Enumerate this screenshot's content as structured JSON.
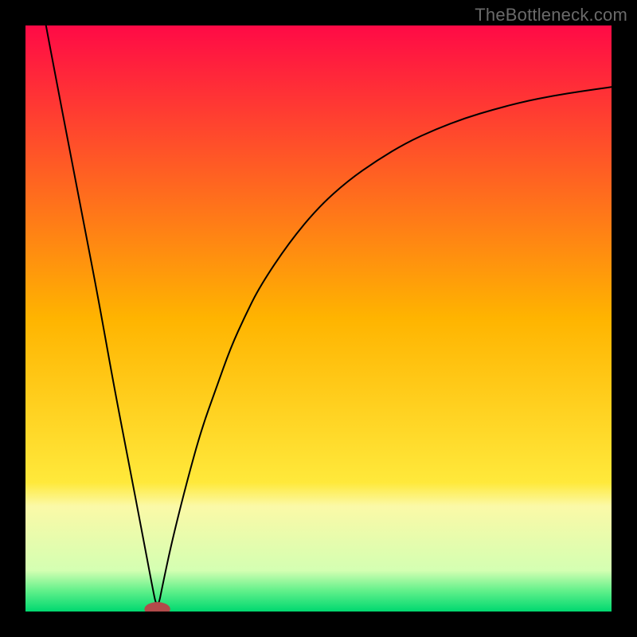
{
  "watermark": "TheBottleneck.com",
  "chart_data": {
    "type": "line",
    "title": "",
    "xlabel": "",
    "ylabel": "",
    "xlim": [
      0,
      100
    ],
    "ylim": [
      0,
      100
    ],
    "grid": false,
    "legend": false,
    "background_gradient": {
      "stops": [
        {
          "offset": 0.0,
          "color": "#ff0a46"
        },
        {
          "offset": 0.5,
          "color": "#ffb400"
        },
        {
          "offset": 0.78,
          "color": "#ffe93b"
        },
        {
          "offset": 0.82,
          "color": "#fbf9a7"
        },
        {
          "offset": 0.93,
          "color": "#d4ffb2"
        },
        {
          "offset": 0.965,
          "color": "#60f08a"
        },
        {
          "offset": 1.0,
          "color": "#00d870"
        }
      ]
    },
    "min_marker": {
      "x": 22.5,
      "y": 0,
      "radius_x": 2.2,
      "radius_y": 1.2,
      "color": "#b24a4a"
    },
    "series": [
      {
        "name": "bottleneck-curve",
        "color": "#000000",
        "stroke_width": 2,
        "x": [
          3.5,
          5,
          7.5,
          10,
          12.5,
          15,
          17.5,
          20,
          21.5,
          22.5,
          23.5,
          25,
          27.5,
          30,
          32.5,
          35,
          37.5,
          40,
          45,
          50,
          55,
          60,
          65,
          70,
          75,
          80,
          85,
          90,
          95,
          100
        ],
        "y": [
          100,
          92,
          79,
          66,
          53,
          39,
          26,
          13,
          5,
          0,
          5,
          12,
          22,
          31,
          38,
          45,
          50.5,
          55.5,
          63,
          69,
          73.5,
          77,
          80,
          82.3,
          84.2,
          85.7,
          87,
          88,
          88.8,
          89.5
        ]
      }
    ]
  }
}
